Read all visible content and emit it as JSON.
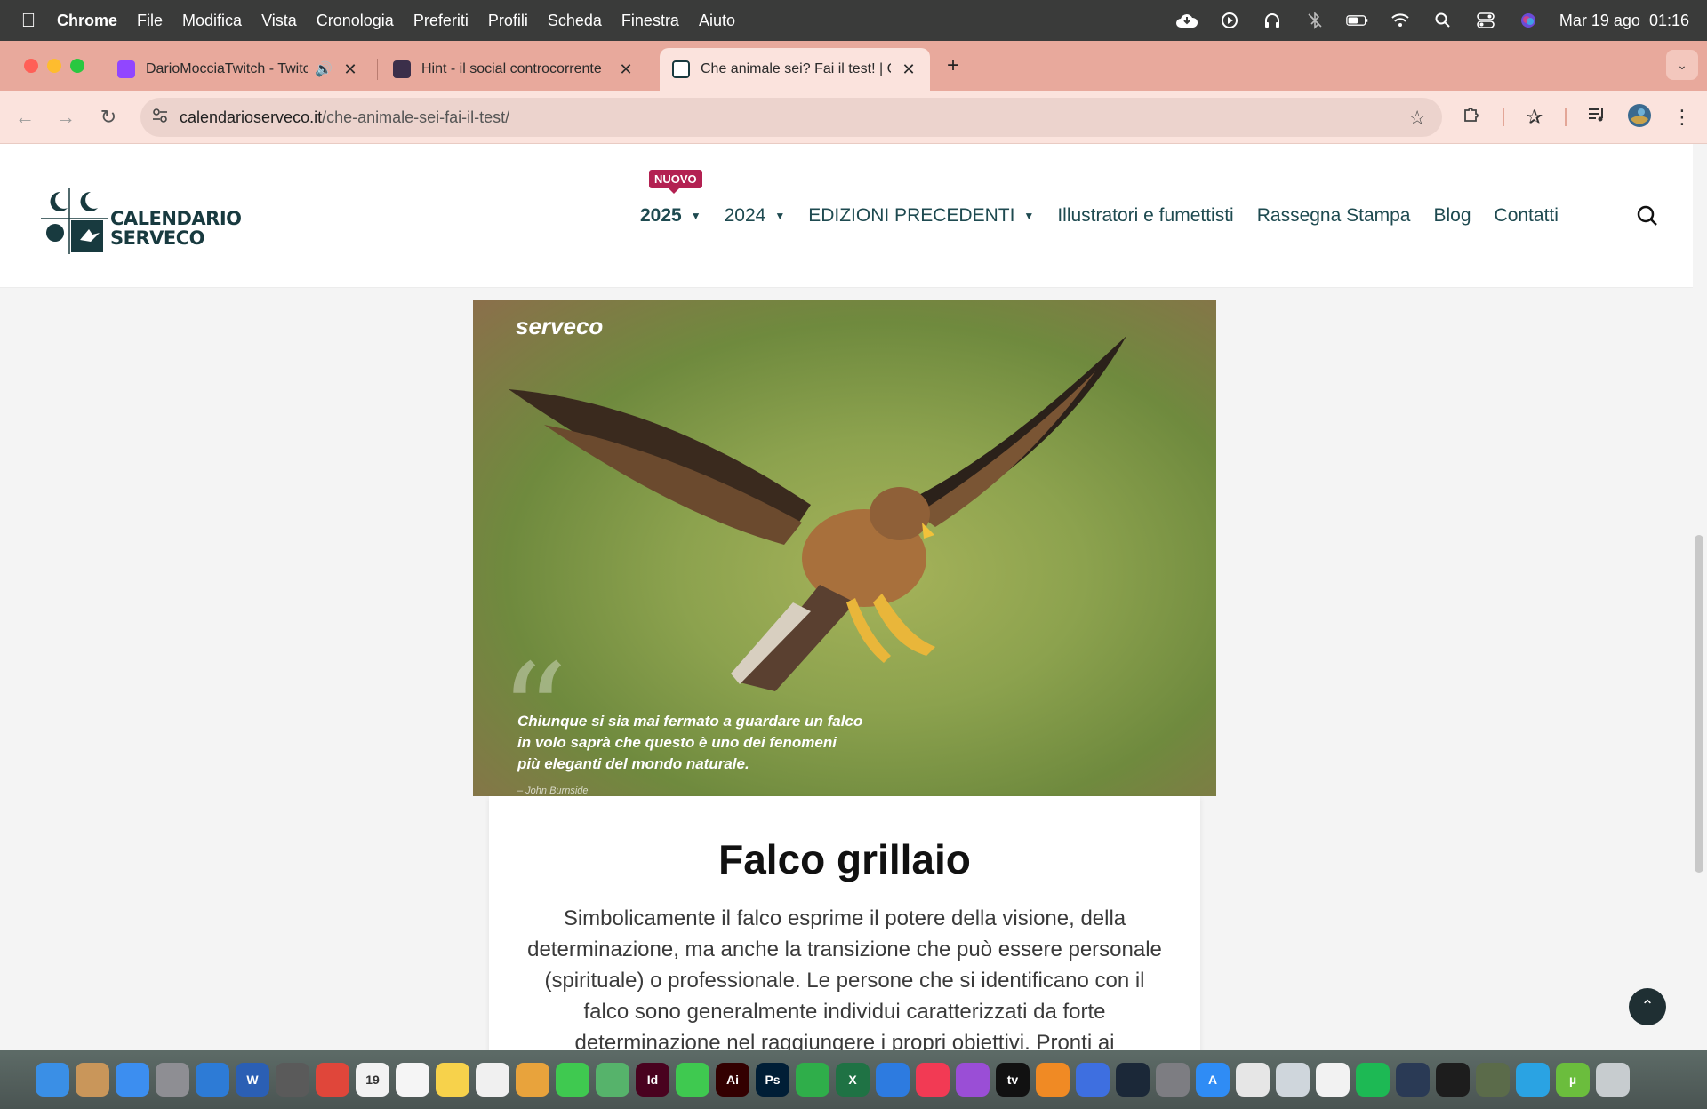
{
  "menubar": {
    "app": "Chrome",
    "items": [
      "File",
      "Modifica",
      "Vista",
      "Cronologia",
      "Preferiti",
      "Profili",
      "Scheda",
      "Finestra",
      "Aiuto"
    ],
    "clock": "Mar 19 ago  01:16"
  },
  "tabs": [
    {
      "title": "DarioMocciaTwitch - Twitch",
      "favicon_color": "#9146ff",
      "audio": true
    },
    {
      "title": "Hint - il social controcorrente",
      "favicon_color": "#3b2f4a",
      "audio": false
    },
    {
      "title": "Che animale sei? Fai il test! | Calendario Serveco",
      "favicon_color": "#183a3f",
      "audio": false
    }
  ],
  "toolbar": {
    "url_domain": "calendarioserveco.it",
    "url_path": "/che-animale-sei-fai-il-test/"
  },
  "site": {
    "logo": {
      "line1": "CALENDARIO",
      "line2": "SERVECO"
    },
    "nav": [
      {
        "label": "2025",
        "badge": "NUOVO",
        "dropdown": true,
        "bold": true
      },
      {
        "label": "2024",
        "dropdown": true
      },
      {
        "label": "EDIZIONI PRECEDENTI",
        "dropdown": true
      },
      {
        "label": "Illustratori e fumettisti"
      },
      {
        "label": "Rassegna Stampa"
      },
      {
        "label": "Blog"
      },
      {
        "label": "Contatti"
      }
    ],
    "hero": {
      "brand": "serveco",
      "quote_lines": [
        "Chiunque si sia mai fermato a guardare un falco",
        "in volo saprà che questo è uno dei fenomeni",
        "più eleganti del mondo naturale."
      ],
      "author": "– John Burnside"
    },
    "result": {
      "title": "Falco grillaio",
      "text": "Simbolicamente il falco esprime il potere della visione, della determinazione, ma anche la transizione che può essere personale (spirituale) o professionale. Le persone che si identificano con il falco sono generalmente individui caratterizzati da forte determinazione nel raggiungere i propri obiettivi. Pronti ai cambiamenti, dotati di un forte"
    }
  },
  "dock": {
    "apps": [
      {
        "name": "finder-icon",
        "color": "#3a8fe6",
        "label": ""
      },
      {
        "name": "contacts-icon",
        "color": "#c9965a",
        "label": ""
      },
      {
        "name": "mail-icon",
        "color": "#3c8ef0",
        "label": ""
      },
      {
        "name": "launchpad-icon",
        "color": "#8e8e93",
        "label": ""
      },
      {
        "name": "testflight-icon",
        "color": "#2d7bd6",
        "label": ""
      },
      {
        "name": "word-icon",
        "color": "#2b5fb4",
        "label": "W"
      },
      {
        "name": "calculator-icon",
        "color": "#5a5a5a",
        "label": ""
      },
      {
        "name": "chrome-icon",
        "color": "#e0463a",
        "label": ""
      },
      {
        "name": "calendar-icon",
        "color": "#f2f2f2",
        "label": "19"
      },
      {
        "name": "reminders-icon",
        "color": "#f5f5f5",
        "label": ""
      },
      {
        "name": "notes-icon",
        "color": "#f7d24b",
        "label": ""
      },
      {
        "name": "freeform-icon",
        "color": "#f0f0f0",
        "label": ""
      },
      {
        "name": "photos-icon",
        "color": "#e8a33c",
        "label": ""
      },
      {
        "name": "messages-icon",
        "color": "#3fc950",
        "label": ""
      },
      {
        "name": "maps-icon",
        "color": "#56b36b",
        "label": ""
      },
      {
        "name": "indesign-icon",
        "color": "#49021f",
        "label": "Id"
      },
      {
        "name": "facetime-icon",
        "color": "#3fc950",
        "label": ""
      },
      {
        "name": "illustrator-icon",
        "color": "#330000",
        "label": "Ai"
      },
      {
        "name": "photoshop-icon",
        "color": "#001e36",
        "label": "Ps"
      },
      {
        "name": "numbers-icon",
        "color": "#2fae4a",
        "label": ""
      },
      {
        "name": "excel-icon",
        "color": "#1f7244",
        "label": "X"
      },
      {
        "name": "keynote-icon",
        "color": "#2d7be0",
        "label": ""
      },
      {
        "name": "music-icon",
        "color": "#f23a54",
        "label": ""
      },
      {
        "name": "podcasts-icon",
        "color": "#9a4ed6",
        "label": ""
      },
      {
        "name": "appletv-icon",
        "color": "#111111",
        "label": "tv"
      },
      {
        "name": "books-icon",
        "color": "#f08a24",
        "label": ""
      },
      {
        "name": "notion-icon",
        "color": "#3e6fe0",
        "label": ""
      },
      {
        "name": "steam-icon",
        "color": "#1b2838",
        "label": ""
      },
      {
        "name": "settings-icon",
        "color": "#7d7d82",
        "label": ""
      },
      {
        "name": "appstore-icon",
        "color": "#2f8cf5",
        "label": "A"
      },
      {
        "name": "preview-icon",
        "color": "#e6e6e6",
        "label": ""
      },
      {
        "name": "finder-window-icon",
        "color": "#cfd6dc",
        "label": ""
      },
      {
        "name": "textedit-icon",
        "color": "#f2f2f2",
        "label": ""
      },
      {
        "name": "spotify-icon",
        "color": "#1db954",
        "label": ""
      },
      {
        "name": "quicktime-icon",
        "color": "#2a3a55",
        "label": ""
      },
      {
        "name": "terminal-icon",
        "color": "#1d1d1d",
        "label": ""
      },
      {
        "name": "game-icon",
        "color": "#5b6b4a",
        "label": ""
      },
      {
        "name": "telegram-icon",
        "color": "#2aa3e3",
        "label": ""
      },
      {
        "name": "utorrent-icon",
        "color": "#6bbd3d",
        "label": "µ"
      },
      {
        "name": "trash-icon",
        "color": "#c7cccf",
        "label": ""
      }
    ]
  }
}
